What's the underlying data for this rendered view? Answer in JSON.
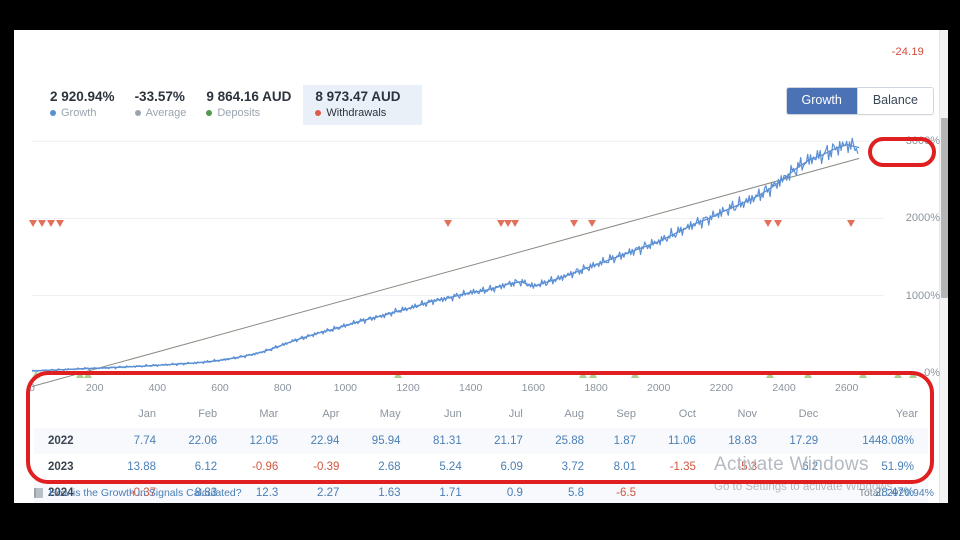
{
  "header": {
    "negative_label": "-24.19",
    "toggle": {
      "options": [
        "Growth",
        "Balance"
      ],
      "growth_label": "Growth",
      "balance_label": "Balance",
      "active": "Growth"
    }
  },
  "stats": [
    {
      "value": "2 920.94%",
      "label": "Growth",
      "color": "#5b8fd4",
      "highlight": false
    },
    {
      "value": "-33.57%",
      "label": "Average",
      "color": "#9aa4af",
      "highlight": false
    },
    {
      "value": "9 864.16 AUD",
      "label": "Deposits",
      "color": "#4f9a4f",
      "highlight": false
    },
    {
      "value": "8 973.47 AUD",
      "label": "Withdrawals",
      "color": "#e05a4a",
      "highlight": true
    }
  ],
  "footer": {
    "link_text": "How is the Growth in Signals Calculated?",
    "total_prefix": "Total: ",
    "total_value": "2920.94%"
  },
  "watermark": {
    "title": "Activate Windows",
    "subtitle": "Go to Settings to activate Windows."
  },
  "table": {
    "columns": [
      "",
      "Jan",
      "Feb",
      "Mar",
      "Apr",
      "May",
      "Jun",
      "Jul",
      "Aug",
      "Sep",
      "Oct",
      "Nov",
      "Dec",
      "Year"
    ],
    "rows": [
      {
        "year": "2022",
        "months": [
          "7.74",
          "22.06",
          "12.05",
          "22.94",
          "95.94",
          "81.31",
          "21.17",
          "25.88",
          "1.87",
          "11.06",
          "18.83",
          "17.29"
        ],
        "total": "1448.08%"
      },
      {
        "year": "2023",
        "months": [
          "13.88",
          "6.12",
          "-0.96",
          "-0.39",
          "2.68",
          "5.24",
          "6.09",
          "3.72",
          "8.01",
          "-1.35",
          "-5.3",
          "6.2"
        ],
        "total": "51.9%"
      },
      {
        "year": "2024",
        "months": [
          "-0.37",
          "8.83",
          "12.3",
          "2.27",
          "1.63",
          "1.71",
          "0.9",
          "5.8",
          "-6.5",
          "",
          "",
          ""
        ],
        "total": "28.47%"
      }
    ]
  },
  "chart_data": {
    "type": "line",
    "title": "",
    "xlabel": "",
    "ylabel": "",
    "xlim": [
      0,
      2700
    ],
    "ylim": [
      -200,
      3200
    ],
    "grid": true,
    "legend_position": "top-left",
    "y_ticks": [
      "0%",
      "1000%",
      "2000%",
      "3000%"
    ],
    "y_tick_values": [
      0,
      1000,
      2000,
      3000
    ],
    "x_ticks": [
      "0",
      "200",
      "400",
      "600",
      "800",
      "1000",
      "1200",
      "1400",
      "1600",
      "1800",
      "2000",
      "2200",
      "2400",
      "2600"
    ],
    "x_tick_values": [
      0,
      200,
      400,
      600,
      800,
      1000,
      1200,
      1400,
      1600,
      1800,
      2000,
      2200,
      2400,
      2600
    ],
    "series": [
      {
        "name": "Growth",
        "color": "#5b8fd4",
        "type": "line",
        "x": [
          0,
          40,
          80,
          120,
          160,
          200,
          240,
          280,
          320,
          360,
          400,
          440,
          480,
          520,
          560,
          600,
          640,
          680,
          720,
          760,
          800,
          840,
          880,
          920,
          960,
          1000,
          1040,
          1080,
          1120,
          1160,
          1200,
          1240,
          1280,
          1320,
          1360,
          1400,
          1440,
          1480,
          1520,
          1560,
          1600,
          1640,
          1680,
          1720,
          1760,
          1800,
          1840,
          1880,
          1920,
          1960,
          2000,
          2040,
          2080,
          2120,
          2160,
          2200,
          2240,
          2280,
          2320,
          2360,
          2400,
          2440,
          2480,
          2520,
          2560,
          2600,
          2640
        ],
        "y": [
          20,
          28,
          35,
          42,
          50,
          55,
          62,
          70,
          78,
          85,
          95,
          105,
          115,
          125,
          140,
          160,
          185,
          215,
          250,
          300,
          360,
          420,
          470,
          520,
          560,
          610,
          660,
          700,
          740,
          790,
          830,
          880,
          930,
          960,
          1000,
          1040,
          1060,
          1100,
          1150,
          1180,
          1120,
          1170,
          1220,
          1280,
          1340,
          1400,
          1460,
          1520,
          1580,
          1640,
          1700,
          1780,
          1860,
          1940,
          2000,
          2080,
          2150,
          2220,
          2300,
          2400,
          2520,
          2650,
          2760,
          2820,
          2900,
          2960,
          2920
        ]
      },
      {
        "name": "Average",
        "color": "#8a8a82",
        "type": "line",
        "x": [
          0,
          2640
        ],
        "y": [
          -180,
          2780
        ]
      }
    ],
    "markers": {
      "withdrawals": {
        "name": "Withdrawals",
        "color": "#e2705a",
        "x": [
          15,
          24,
          33,
          42,
          430,
          483,
          490,
          497,
          556,
          574,
          750,
          760,
          833
        ]
      },
      "deposits": {
        "name": "Deposits",
        "color": "#8cc06a",
        "x": [
          18,
          62,
          70,
          380,
          565,
          575,
          617,
          752,
          790,
          845,
          880,
          895
        ]
      }
    }
  }
}
